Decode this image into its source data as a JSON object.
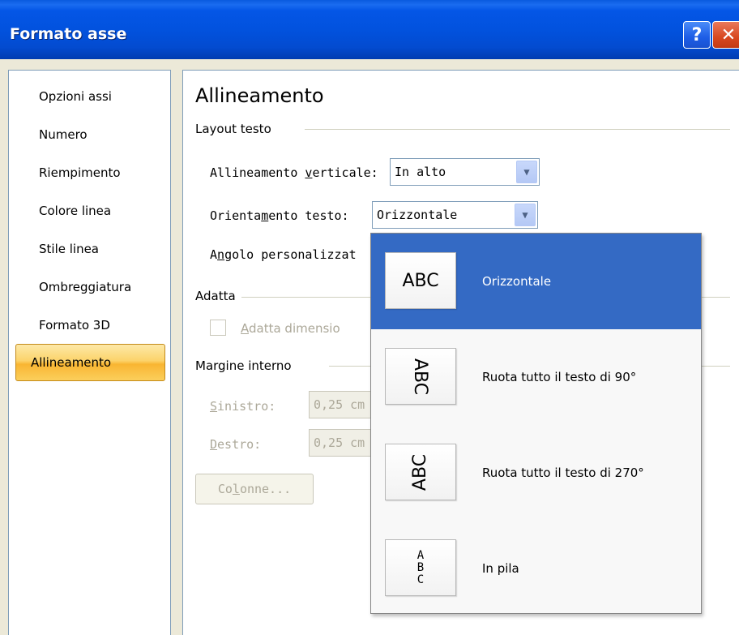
{
  "window": {
    "title": "Formato asse",
    "help_label": "?",
    "close_label": "✕"
  },
  "nav": {
    "items": [
      "Opzioni assi",
      "Numero",
      "Riempimento",
      "Colore linea",
      "Stile linea",
      "Ombreggiatura",
      "Formato 3D"
    ],
    "active": "Allineamento"
  },
  "content": {
    "heading": "Allineamento",
    "layout_section": "Layout testo",
    "vertical_label_pre": "Allineamento ",
    "vertical_label_key": "v",
    "vertical_label_post": "erticale:",
    "vertical_value": "In alto",
    "orient_label_pre": "Orienta",
    "orient_label_key": "m",
    "orient_label_post": "ento testo:",
    "orient_value": "Orizzontale",
    "angle_label_pre": "A",
    "angle_label_key": "n",
    "angle_label_post": "golo personalizzat",
    "fit_section": "Adatta",
    "fit_checkbox_key": "A",
    "fit_checkbox_label": "datta dimensio",
    "margin_section": "Margine interno",
    "left_label_key": "S",
    "left_label": "inistro:",
    "left_value": "0,25 cm",
    "right_label_key": "D",
    "right_label": "estro:",
    "right_value": "0,25 cm",
    "columns_pre": "Co",
    "columns_key": "l",
    "columns_post": "onne..."
  },
  "dropdown": {
    "options": [
      {
        "thumb": "ABC",
        "label": "Orizzontale",
        "selected": true
      },
      {
        "thumb": "ABC",
        "label": "Ruota tutto il testo di 90°",
        "selected": false
      },
      {
        "thumb": "ABC",
        "label": "Ruota tutto il testo di 270°",
        "selected": false
      },
      {
        "thumb": [
          "A",
          "B",
          "C"
        ],
        "label": "In pila",
        "selected": false
      }
    ]
  },
  "colors": {
    "title_bar": "#0252de",
    "selected_option": "#346ac4",
    "active_nav": "#f9b532"
  }
}
